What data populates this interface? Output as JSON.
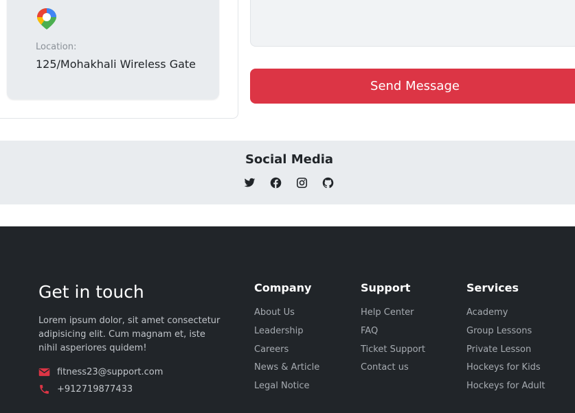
{
  "location": {
    "label": "Location:",
    "value": "125/Mohakhali Wireless Gate",
    "icon": "map-pin-icon"
  },
  "form": {
    "send_label": "Send Message"
  },
  "social": {
    "title": "Social Media",
    "icons": [
      "twitter-icon",
      "facebook-icon",
      "instagram-icon",
      "github-icon"
    ]
  },
  "footer": {
    "title": "Get in touch",
    "description": "Lorem ipsum dolor, sit amet consectetur adipisicing elit. Cum magnam et, iste nihil asperiores quidem!",
    "email": "fitness23@support.com",
    "phone": "+912719877433",
    "columns": [
      {
        "title": "Company",
        "links": [
          "About Us",
          "Leadership",
          "Careers",
          "News & Article",
          "Legal Notice"
        ]
      },
      {
        "title": "Support",
        "links": [
          "Help Center",
          "FAQ",
          "Ticket Support",
          "Contact us"
        ]
      },
      {
        "title": "Services",
        "links": [
          "Academy",
          "Group Lessons",
          "Private Lesson",
          "Hockeys for Kids",
          "Hockeys for Adult"
        ]
      }
    ]
  },
  "colors": {
    "accent": "#dc3545",
    "footer_bg": "#212529",
    "panel_bg": "#e9ecef"
  }
}
